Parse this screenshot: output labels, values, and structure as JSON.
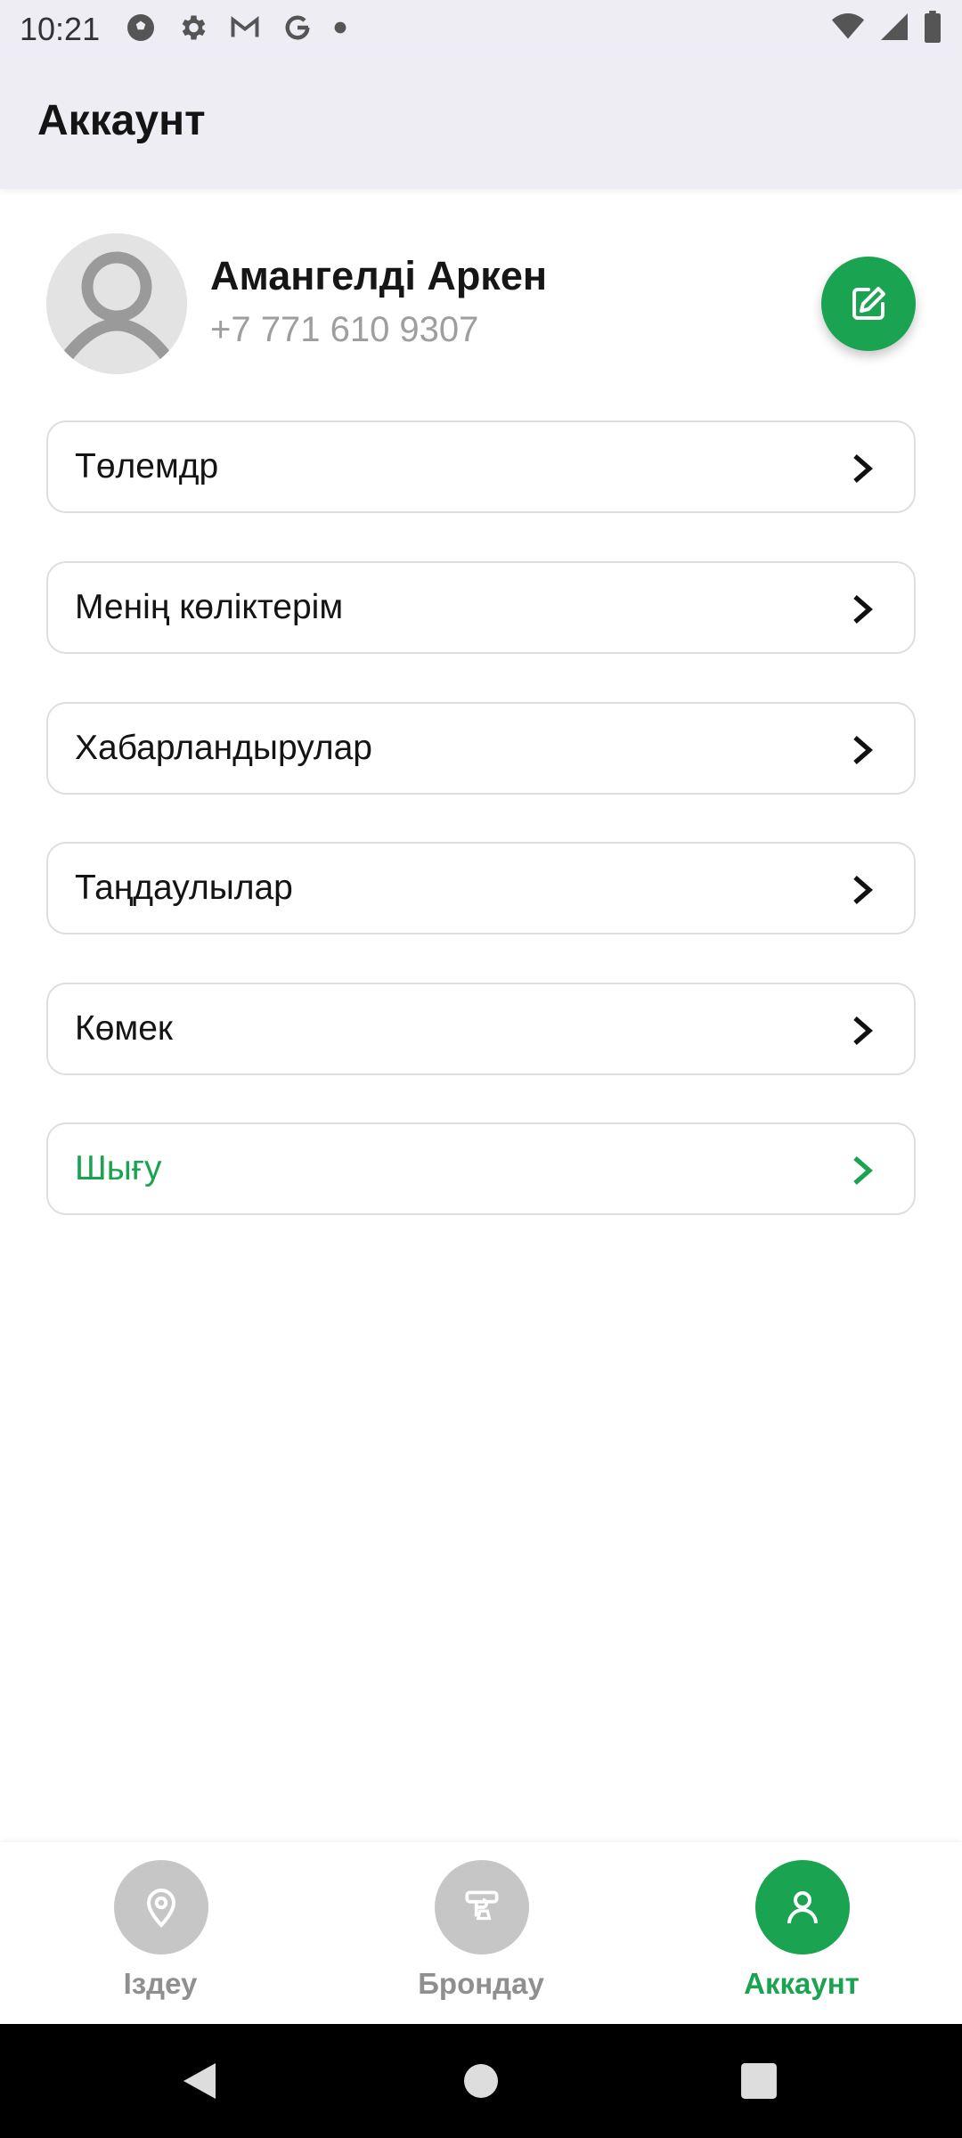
{
  "status_bar": {
    "time": "10:21",
    "left_icons": [
      "soccer-ball-icon",
      "gear-icon",
      "gmail-icon",
      "google-icon",
      "dot-icon"
    ],
    "right_icons": [
      "wifi-icon",
      "cell-signal-icon",
      "battery-icon"
    ]
  },
  "app_bar": {
    "title": "Аккаунт"
  },
  "profile": {
    "name": "Амангелді Аркен",
    "phone": "+7 771 610 9307"
  },
  "menu": {
    "items": [
      {
        "label": "Төлемдр"
      },
      {
        "label": "Менің көліктерім"
      },
      {
        "label": "Хабарландырулар"
      },
      {
        "label": "Таңдаулылар"
      },
      {
        "label": "Көмек"
      },
      {
        "label": "Шығу"
      }
    ]
  },
  "bottom_nav": {
    "items": [
      {
        "label": "Іздеу",
        "icon": "location-pin-icon"
      },
      {
        "label": "Брондау",
        "icon": "parking-icon"
      },
      {
        "label": "Аккаунт",
        "icon": "person-icon",
        "active": true
      }
    ]
  },
  "colors": {
    "accent": "#1aa350",
    "inactive_circle": "#c6c6c6",
    "inactive_label": "#8f8f8f",
    "bar_background": "#efedf4"
  }
}
